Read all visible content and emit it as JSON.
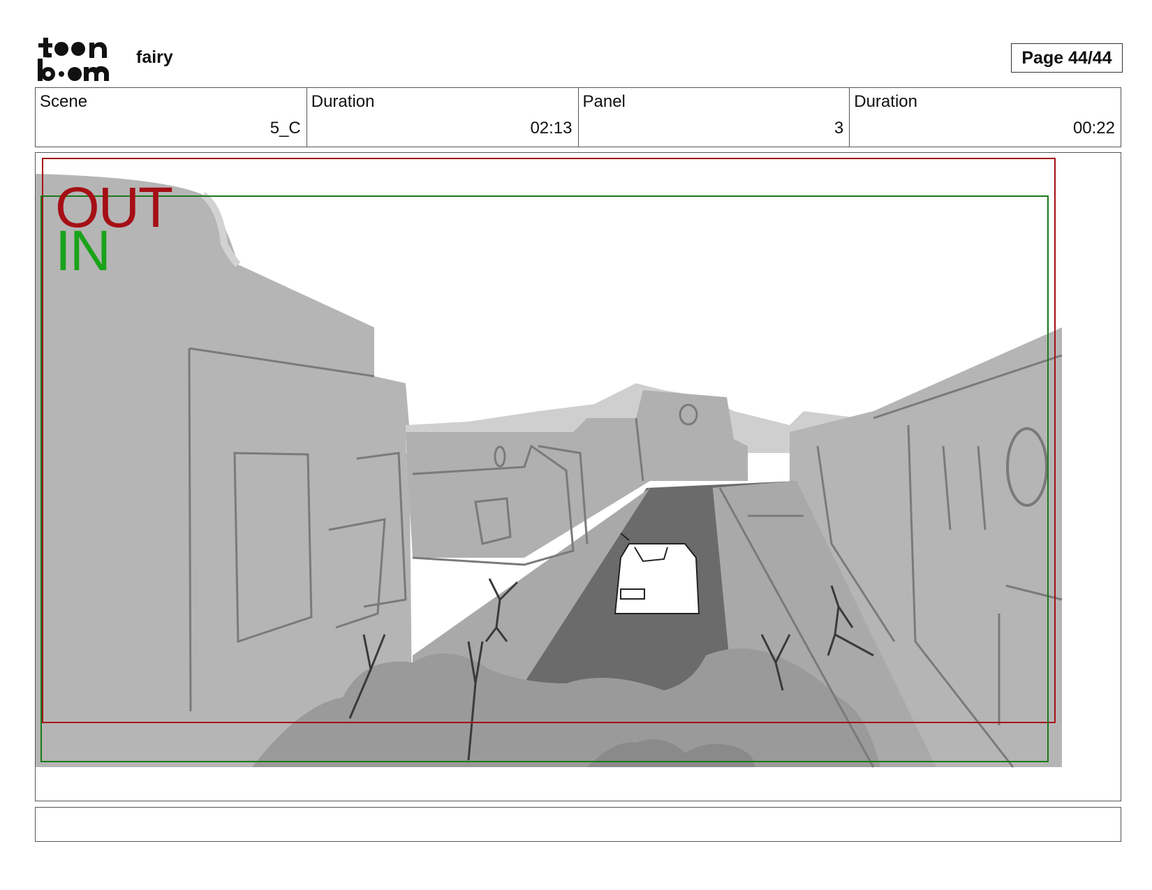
{
  "header": {
    "logo_text": "toon boom",
    "project_name": "fairy",
    "page_label": "Page 44/44"
  },
  "info": {
    "scene_label": "Scene",
    "scene_value": "5_C",
    "scene_duration_label": "Duration",
    "scene_duration_value": "02:13",
    "panel_label": "Panel",
    "panel_value": "3",
    "panel_duration_label": "Duration",
    "panel_duration_value": "00:22"
  },
  "panel": {
    "out_label": "OUT",
    "in_label": "IN"
  },
  "notes": {
    "text": ""
  },
  "colors": {
    "out_frame": "#a50f15",
    "in_frame": "#1aa31a"
  }
}
